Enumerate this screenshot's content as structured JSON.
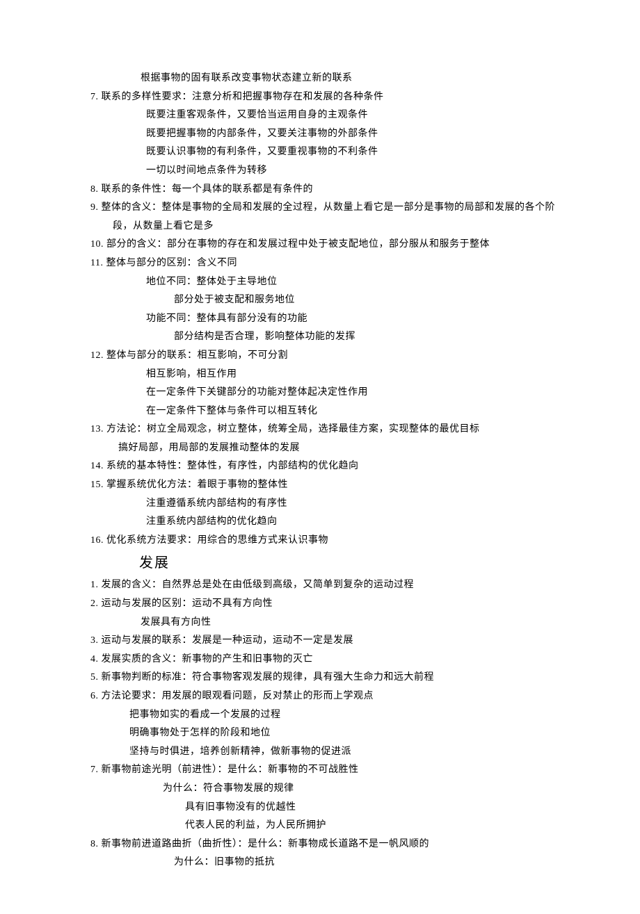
{
  "lines": [
    {
      "text": "                  根据事物的固有联系改变事物状态建立新的联系",
      "class": ""
    },
    {
      "text": "7. 联系的多样性要求：注意分析和把握事物存在和发展的各种条件",
      "class": ""
    },
    {
      "text": "                    既要注重客观条件，又要恰当运用自身的主观条件",
      "class": ""
    },
    {
      "text": "                    既要把握事物的内部条件，又要关注事物的外部条件",
      "class": ""
    },
    {
      "text": "                    既要认识事物的有利条件，又要重视事物的不利条件",
      "class": ""
    },
    {
      "text": "                    一切以时间地点条件为转移",
      "class": ""
    },
    {
      "text": "8. 联系的条件性：每一个具体的联系都是有条件的",
      "class": ""
    },
    {
      "text": "9. 整体的含义：整体是事物的全局和发展的全过程，从数量上看它是一部分是事物的局部和发展的各个阶",
      "class": ""
    },
    {
      "text": "        段，从数量上看它是多",
      "class": ""
    },
    {
      "text": "10. 部分的含义：部分在事物的存在和发展过程中处于被支配地位，部分服从和服务于整体",
      "class": ""
    },
    {
      "text": "11. 整体与部分的区别：含义不同",
      "class": ""
    },
    {
      "text": "                    地位不同：整体处于主导地位",
      "class": ""
    },
    {
      "text": "                              部分处于被支配和服务地位",
      "class": ""
    },
    {
      "text": "                    功能不同：整体具有部分没有的功能",
      "class": ""
    },
    {
      "text": "                              部分结构是否合理，影响整体功能的发挥",
      "class": ""
    },
    {
      "text": "12. 整体与部分的联系：相互影响，不可分割",
      "class": ""
    },
    {
      "text": "                    相互影响，相互作用",
      "class": ""
    },
    {
      "text": "                    在一定条件下关键部分的功能对整体起决定性作用",
      "class": ""
    },
    {
      "text": "                    在一定条件下整体与条件可以相互转化",
      "class": ""
    },
    {
      "text": "13. 方法论：树立全局观念，树立整体，统筹全局，选择最佳方案，实现整体的最优目标",
      "class": ""
    },
    {
      "text": "          搞好局部，用局部的发展推动整体的发展",
      "class": ""
    },
    {
      "text": "14. 系统的基本特性：整体性，有序性，内部结构的优化趋向",
      "class": ""
    },
    {
      "text": "15. 掌握系统优化方法：着眼于事物的整体性",
      "class": ""
    },
    {
      "text": "                    注重遵循系统内部结构的有序性",
      "class": ""
    },
    {
      "text": "                    注重系统内部结构的优化趋向",
      "class": ""
    },
    {
      "text": "16. 优化系统方法要求：用综合的思维方式来认识事物",
      "class": ""
    },
    {
      "text": "",
      "class": ""
    },
    {
      "text": "          发展",
      "class": "heading"
    },
    {
      "text": "1. 发展的含义：自然界总是处在由低级到高级，又简单到复杂的运动过程",
      "class": ""
    },
    {
      "text": "2. 运动与发展的区别：运动不具有方向性",
      "class": ""
    },
    {
      "text": "                  发展具有方向性",
      "class": ""
    },
    {
      "text": "3. 运动与发展的联系：发展是一种运动，运动不一定是发展",
      "class": ""
    },
    {
      "text": "4. 发展实质的含义：新事物的产生和旧事物的灭亡",
      "class": ""
    },
    {
      "text": "5. 新事物判断的标准：符合事物客观发展的规律，具有强大生命力和远大前程",
      "class": ""
    },
    {
      "text": "6. 方法论要求：用发展的眼观看问题，反对禁止的形而上学观点",
      "class": ""
    },
    {
      "text": "              把事物如实的看成一个发展的过程",
      "class": ""
    },
    {
      "text": "              明确事物处于怎样的阶段和地位",
      "class": ""
    },
    {
      "text": "              坚持与时俱进，培养创新精神，做新事物的促进派",
      "class": ""
    },
    {
      "text": "7. 新事物前途光明（前进性）：是什么：新事物的不可战胜性",
      "class": ""
    },
    {
      "text": "                          为什么：符合事物发展的规律",
      "class": ""
    },
    {
      "text": "                                  具有旧事物没有的优越性",
      "class": ""
    },
    {
      "text": "                                  代表人民的利益，为人民所拥护",
      "class": ""
    },
    {
      "text": "8. 新事物前进道路曲折（曲折性）：是什么：新事物成长道路不是一帆风顺的",
      "class": ""
    },
    {
      "text": "                              为什么：旧事物的抵抗",
      "class": ""
    }
  ]
}
